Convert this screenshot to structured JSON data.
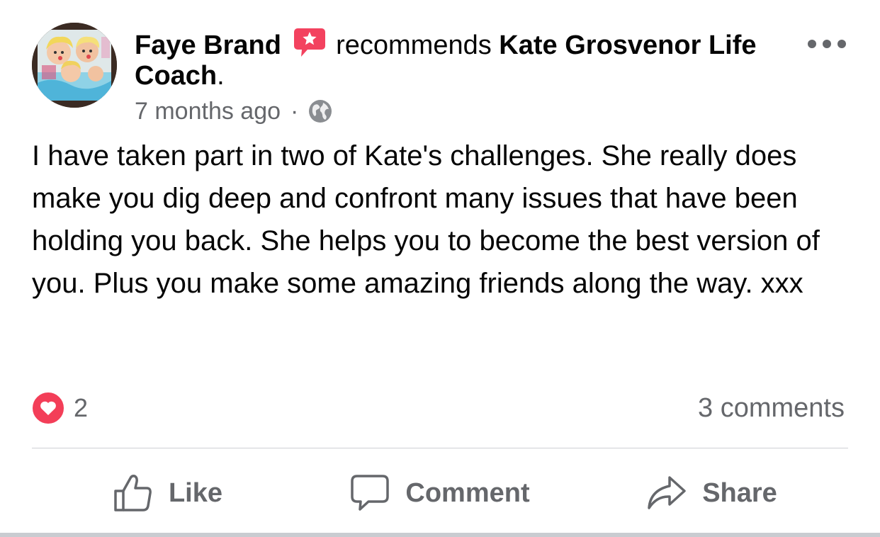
{
  "post": {
    "author": "Faye Brand",
    "action_text": "recommends",
    "page_name": "Kate Grosvenor Life Coach",
    "page_name_suffix": ".",
    "timestamp": "7 months ago",
    "separator": "·",
    "privacy_icon": "globe-icon",
    "body": "I have taken part in two of Kate's challenges. She really does make you dig deep and confront many issues that have been holding you back. She helps you to become the best version of you. Plus you make some amazing friends along the way. xxx"
  },
  "engagement": {
    "reaction_icon": "heart-icon",
    "reaction_count": "2",
    "comments_label": "3 comments"
  },
  "actions": {
    "like_label": "Like",
    "comment_label": "Comment",
    "share_label": "Share"
  },
  "colors": {
    "recommend_badge": "#f3425f",
    "heart": "#f33e58",
    "secondary_text": "#65676b"
  }
}
